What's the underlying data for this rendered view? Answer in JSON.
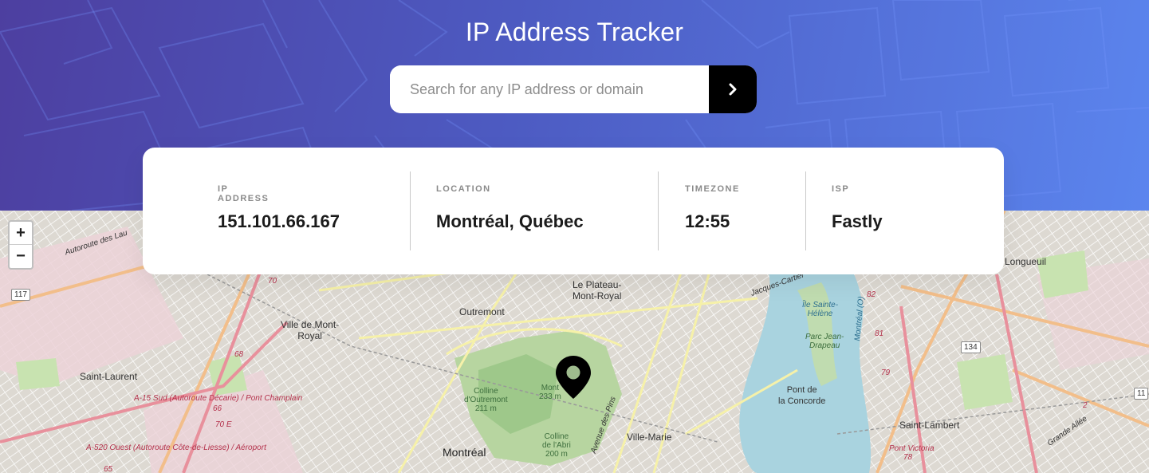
{
  "header": {
    "title": "IP Address Tracker",
    "search_placeholder": "Search for any IP address or domain",
    "search_value": "",
    "submit_icon": "chevron-right-icon"
  },
  "info": {
    "ip": {
      "label": "IP ADDRESS",
      "value": "151.101.66.167"
    },
    "location": {
      "label": "LOCATION",
      "value": "Montréal, Québec"
    },
    "timezone": {
      "label": "TIMEZONE",
      "value": "12:55"
    },
    "isp": {
      "label": "ISP",
      "value": "Fastly"
    }
  },
  "map": {
    "zoom_in": "+",
    "zoom_out": "−",
    "marker_icon": "location-pin-icon",
    "labels": {
      "montreal": "Montréal",
      "plateau": "Le Plateau-\nMont-Royal",
      "outremont": "Outremont",
      "ville_mont_royal": "Ville de Mont-\nRoyal",
      "saint_laurent": "Saint-Laurent",
      "ville_marie": "Ville-Marie",
      "longueuil": "Longueuil",
      "saint_lambert": "Saint-Lambert",
      "ile_sainte_helene": "Île Sainte-\nHélène",
      "parc_jean_drapeau": "Parc Jean-\nDrapeau",
      "pont_concorde": "Pont de\nla Concorde",
      "pont_victoria": "Pont Victoria",
      "colline_outremont": "Colline\nd'Outremont\n211 m",
      "mont_royal": "Mont\n233 m",
      "colline_abri": "Colline\nde l'Abri\n200 m",
      "a15": "A-15 Sud (Autoroute Décarie) / Pont Champlain",
      "a520": "A-520 Ouest (Autoroute Côte-de-Liesse) / Aéroport",
      "autoroute_laurentides": "Autoroute des Lau",
      "avenue_des_pins": "Avenue des Pins",
      "grande_allee": "Grande Allée",
      "jacques_cartier": "Jacques-Cartier",
      "montreal_o": "Montréal (O)"
    },
    "shields": [
      "117",
      "70",
      "68",
      "66",
      "70 E",
      "65",
      "134",
      "82",
      "81",
      "79",
      "78",
      "2",
      "11"
    ]
  },
  "colors": {
    "header_start": "#4d3fa0",
    "header_end": "#5b85ee",
    "button_bg": "#000000",
    "label_gray": "#8a8a8a",
    "value_dark": "#1b1b1b"
  }
}
